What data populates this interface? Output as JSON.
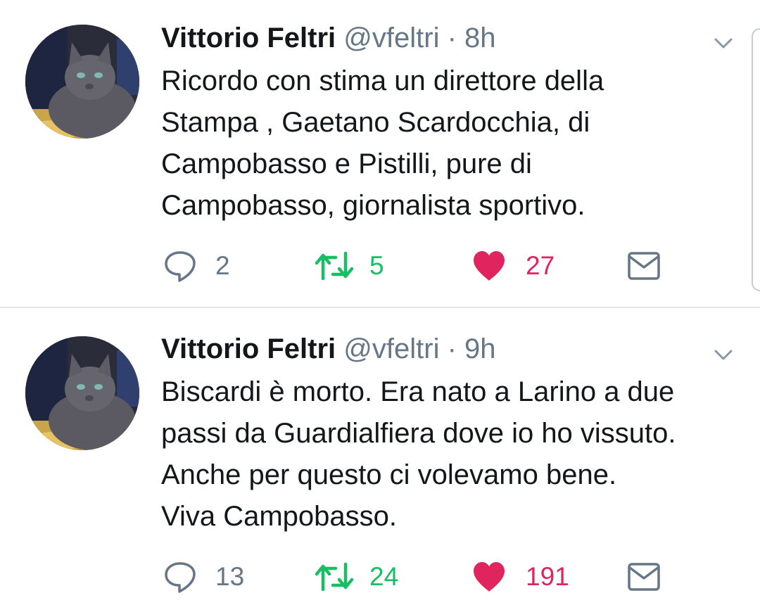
{
  "tweets": [
    {
      "name": "Vittorio Feltri",
      "handle": "@vfeltri",
      "separator": "·",
      "time": "8h",
      "text": "Ricordo con stima un direttore della\nStampa , Gaetano Scardocchia, di\nCampobasso e Pistilli, pure di\nCampobasso, giornalista sportivo.",
      "replies": "2",
      "retweets": "5",
      "likes": "27"
    },
    {
      "name": "Vittorio Feltri",
      "handle": "@vfeltri",
      "separator": "·",
      "time": "9h",
      "text": "Biscardi è morto. Era nato a Larino a due\npassi da Guardialfiera dove io ho vissuto.\nAnche per questo ci volevamo bene.\nViva Campobasso.",
      "replies": "13",
      "retweets": "24",
      "likes": "191"
    }
  ],
  "icons": {
    "avatar": "cat-avatar",
    "menu": "chevron-down-icon",
    "reply": "reply-icon",
    "retweet": "retweet-icon",
    "like": "heart-icon",
    "dm": "envelope-icon"
  },
  "colors": {
    "text": "#14171a",
    "secondary": "#657786",
    "retweet": "#17bf63",
    "like": "#e0245e",
    "divider": "#e1e8ed"
  }
}
